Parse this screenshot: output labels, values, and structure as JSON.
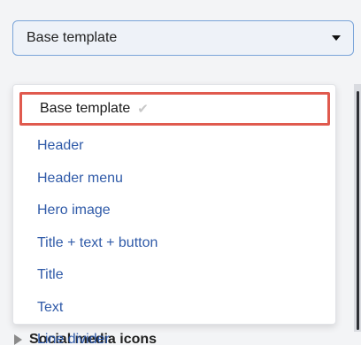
{
  "select": {
    "value": "Base template",
    "caret_icon": "chevron-down-icon"
  },
  "menu": {
    "items": [
      {
        "label": "Base template",
        "selected": true,
        "check_icon": "check-icon"
      },
      {
        "label": "Header"
      },
      {
        "label": "Header menu"
      },
      {
        "label": "Hero image"
      },
      {
        "label": "Title + text + button"
      },
      {
        "label": "Title"
      },
      {
        "label": "Text"
      },
      {
        "label": "Line divider"
      }
    ]
  },
  "below": {
    "label": "Social media icons",
    "icon": "triangle-right-icon"
  },
  "colors": {
    "accent_border": "#7aa4d9",
    "menu_text": "#2f5aa8",
    "highlight": "#e05a4e"
  }
}
